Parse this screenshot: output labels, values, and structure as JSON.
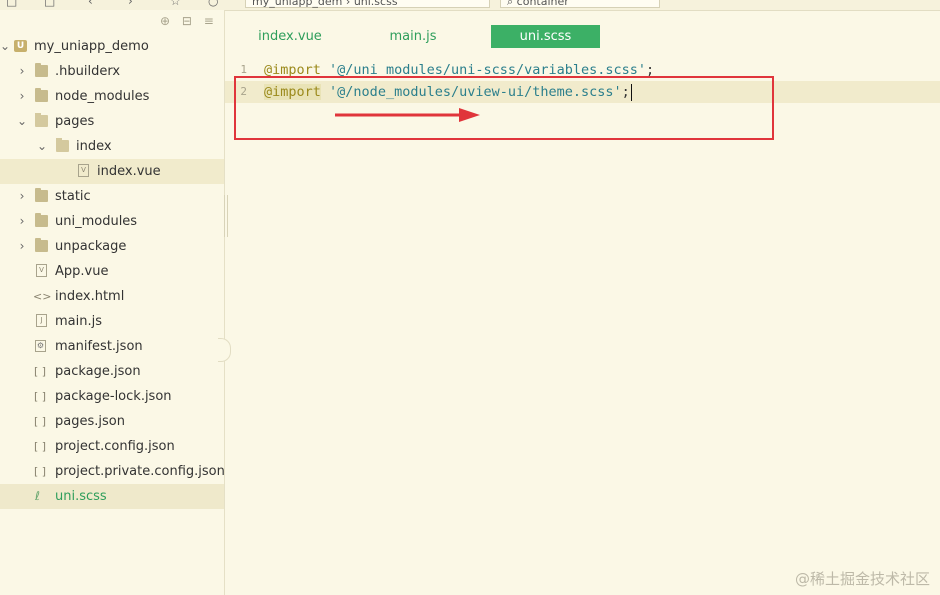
{
  "topbar": {
    "crumb_1": "my_uniapp_dem",
    "crumb_2": "uni.scss",
    "search": "container"
  },
  "sidebar": {
    "project_name": "my_uniapp_demo",
    "items": [
      {
        "label": ".hbuilderx"
      },
      {
        "label": "node_modules"
      },
      {
        "label": "pages"
      },
      {
        "label": "index"
      },
      {
        "label": "index.vue"
      },
      {
        "label": "static"
      },
      {
        "label": "uni_modules"
      },
      {
        "label": "unpackage"
      },
      {
        "label": "App.vue"
      },
      {
        "label": "index.html"
      },
      {
        "label": "main.js"
      },
      {
        "label": "manifest.json"
      },
      {
        "label": "package.json"
      },
      {
        "label": "package-lock.json"
      },
      {
        "label": "pages.json"
      },
      {
        "label": "project.config.json"
      },
      {
        "label": "project.private.config.json"
      },
      {
        "label": "uni.scss"
      }
    ]
  },
  "tabs": [
    {
      "label": "index.vue"
    },
    {
      "label": "main.js"
    },
    {
      "label": "uni.scss"
    }
  ],
  "editor": {
    "lines": [
      {
        "num": "1",
        "keyword": "@import",
        "value": "'@/uni_modules/uni-scss/variables.scss'",
        "end": ";"
      },
      {
        "num": "2",
        "keyword": "@import",
        "value": "'@/node_modules/uview-ui/theme.scss'",
        "end": ";"
      }
    ]
  },
  "watermark": "@稀土掘金技术社区",
  "colors": {
    "accent": "#3cb066",
    "annotation": "#e0353b",
    "background": "#fbf8e6"
  }
}
